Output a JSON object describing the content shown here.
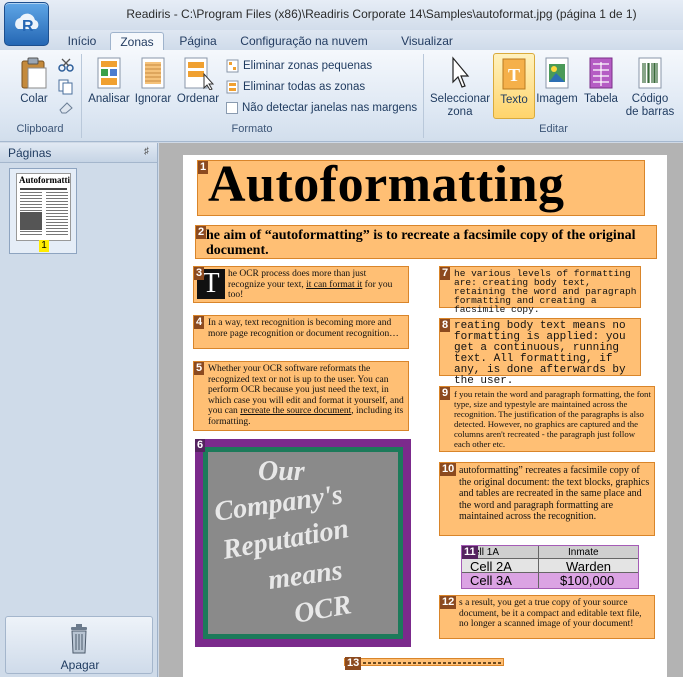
{
  "window": {
    "title": "Readiris - C:\\Program Files (x86)\\Readiris Corporate 14\\Samples\\autoformat.jpg (página 1 de 1)",
    "app_icon": "readiris-logo-icon"
  },
  "tabs": [
    "Início",
    "Zonas",
    "Página",
    "Configuração na nuvem",
    "Visualizar"
  ],
  "active_tab": "Zonas",
  "ribbon": {
    "clipboard": {
      "group_label": "Clipboard",
      "paste_label": "Colar"
    },
    "format": {
      "group_label": "Formato",
      "analyze_label": "Analisar",
      "ignore_label": "Ignorar",
      "order_label": "Ordenar",
      "remove_small": "Eliminar zonas pequenas",
      "remove_all": "Eliminar todas as zonas",
      "no_detect_windows": "Não detectar janelas nas margens"
    },
    "edit": {
      "group_label": "Editar",
      "select_zone": [
        "Seleccionar",
        "zona"
      ],
      "text": "Texto",
      "image": "Imagem",
      "table": "Tabela",
      "barcode": [
        "Código",
        "de barras"
      ]
    }
  },
  "pages_panel": {
    "title": "Páginas",
    "thumbnail_number": "1",
    "delete_label": "Apagar"
  },
  "document": {
    "zones": [
      {
        "n": "1",
        "headline": "Autoformatting"
      },
      {
        "n": "2",
        "text": "he aim of “autoformatting” is to recreate a facsimile copy of the original document."
      },
      {
        "n": "3",
        "dropcap": "T",
        "text_a": "he OCR process does more than just recognize your text, ",
        "link": "it can format it",
        "text_b": " for you too!"
      },
      {
        "n": "4",
        "text": "In a way, text recognition is becoming more and more page recognition or document recognition…"
      },
      {
        "n": "5",
        "text_a": "Whether your OCR software reformats the recognized text or not is up to the user. You can perform OCR because you just need the text, in which case you will edit and format it yourself, and you can ",
        "link": "recreate the source document",
        "text_b": ", including its formatting."
      },
      {
        "n": "6",
        "photo_lines": [
          "Our",
          "Company's",
          "Reputation",
          "means",
          "OCR"
        ]
      },
      {
        "n": "7",
        "text": "he various levels of formatting are: creating body text, retaining the word and paragraph formatting and creating a facsimile copy."
      },
      {
        "n": "8",
        "text": "reating body text means no formatting is applied: you get a continuous, running text. All formatting, if any, is done afterwards by the user."
      },
      {
        "n": "9",
        "text": "f you retain the word and paragraph formatting, the font type, size and typestyle are maintained across the recognition. The justification of the paragraphs is also detected. However, no graphics are captured and the columns aren't recreated - the paragraph just follow each other etc."
      },
      {
        "n": "10",
        "text": "autoformatting” recreates a facsimile copy of the original document: the text blocks, graphics and tables are recreated in the same place and the word and paragraph formatting are maintained across the recognition."
      },
      {
        "n": "11",
        "table": [
          [
            "ell 1A",
            "Inmate"
          ],
          [
            "Cell 2A",
            "Warden"
          ],
          [
            "Cell 3A",
            "$100,000"
          ]
        ]
      },
      {
        "n": "12",
        "text": "s a result, you get a true copy of your source document, be it a compact and editable text file, no longer a scanned image of your document!"
      },
      {
        "n": "13",
        "text": ""
      }
    ]
  },
  "colors": {
    "text_zone": "#ffaa46",
    "image_zone": "#7b2a8c",
    "table_zone": "#d28cdc",
    "ribbon_selected": "#ffd46b"
  }
}
